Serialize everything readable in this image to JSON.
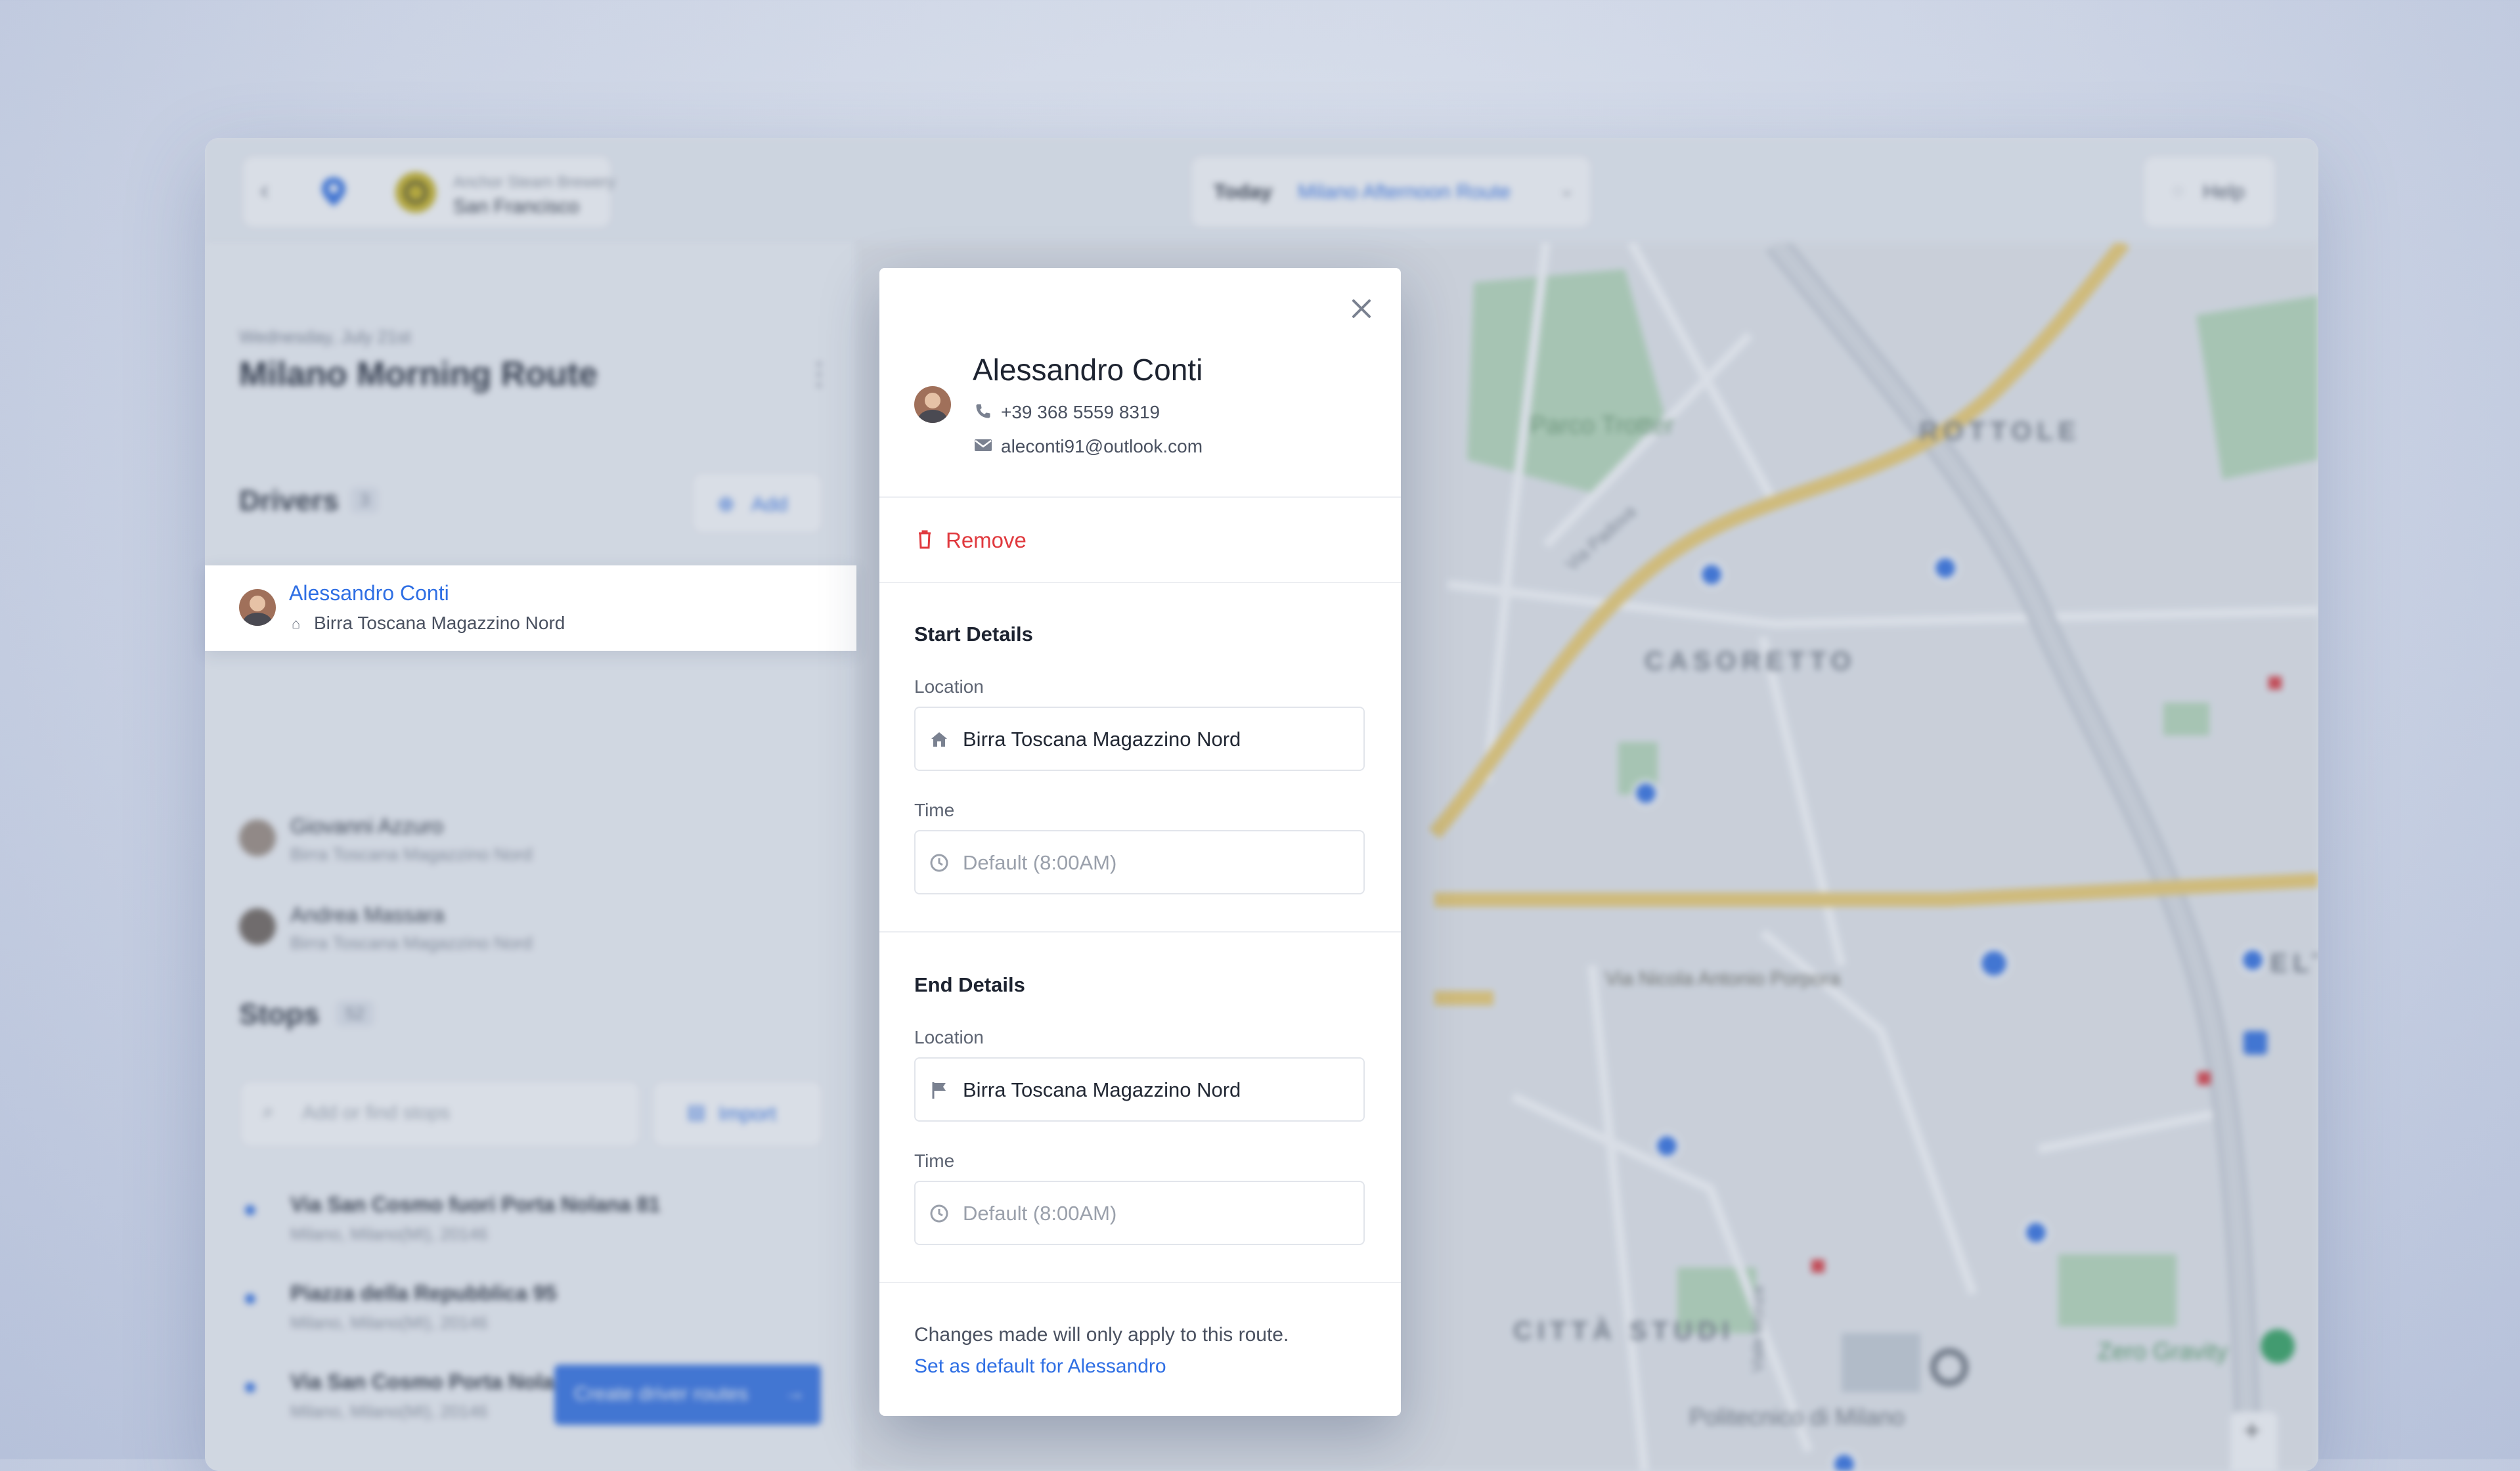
{
  "header": {
    "company_name": "Anchor Steam Brewery",
    "company_city": "San Francisco",
    "date_label": "Today",
    "route_selector": "Milano Afternoon Route",
    "help_label": "Help"
  },
  "route": {
    "date": "Wednesday, July 21st",
    "title": "Milano Morning Route"
  },
  "drivers": {
    "heading": "Drivers",
    "count": "3",
    "add_label": "Add",
    "items": [
      {
        "name": "Alessandro Conti",
        "depot": "Birra Toscana Magazzino Nord"
      },
      {
        "name": "Giovanni Azzuro",
        "depot": "Birra Toscana Magazzino Nord"
      },
      {
        "name": "Andrea Massara",
        "depot": "Birra Toscana Magazzino Nord"
      }
    ]
  },
  "stops": {
    "heading": "Stops",
    "count": "52",
    "search_placeholder": "Add or find stops",
    "import_label": "Import",
    "items": [
      {
        "address": "Via San Cosmo fuori Porta Nolana 81",
        "city": "Milano, Milano(MI), 20146"
      },
      {
        "address": "Piazza della Repubblica 95",
        "city": "Milano, Milano(MI), 20146"
      },
      {
        "address": "Via San Cosmo Porta Nolana 81",
        "city": "Milano, Milano(MI), 20146"
      }
    ]
  },
  "create_button": "Create driver routes",
  "map": {
    "labels": [
      "Parco Trotter",
      "ROTTOLE",
      "CASORETTO",
      "Via Nicola Antonio Porpora",
      "FELT",
      "CITTÀ STUDI",
      "Zero Gravity",
      "Politecnico di Milano",
      "Via Padova",
      "Viale Monza"
    ],
    "colors": {
      "road": "#f2cf6e",
      "park": "#b9dcb9",
      "pin": "#2f6fe4",
      "green_pin": "#2fa35c"
    }
  },
  "modal": {
    "driver_name": "Alessandro Conti",
    "phone": "+39 368 5559 8319",
    "email": "aleconti91@outlook.com",
    "remove_label": "Remove",
    "start": {
      "heading": "Start Details",
      "location_label": "Location",
      "location_value": "Birra Toscana Magazzino Nord",
      "time_label": "Time",
      "time_value": "Default (8:00AM)"
    },
    "end": {
      "heading": "End Details",
      "location_label": "Location",
      "location_value": "Birra Toscana Magazzino Nord",
      "time_label": "Time",
      "time_value": "Default (8:00AM)"
    },
    "note": "Changes made will only apply to this route.",
    "set_default_link": "Set as default for Alessandro"
  },
  "colors": {
    "accent": "#2f6fe4",
    "danger": "#e0393e",
    "text": "#1d2330"
  }
}
